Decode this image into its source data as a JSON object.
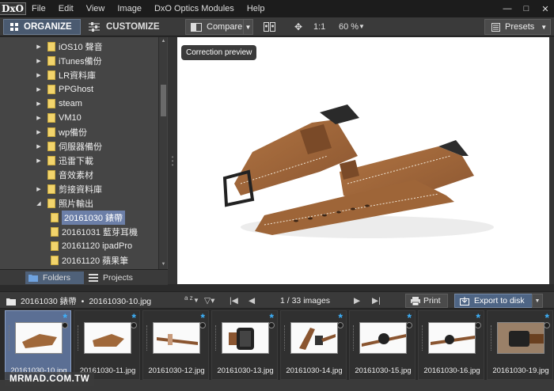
{
  "app": {
    "logo": "DxO"
  },
  "menu": [
    "File",
    "Edit",
    "View",
    "Image",
    "DxO Optics Modules",
    "Help"
  ],
  "toolbar": {
    "organize": "ORGANIZE",
    "customize": "CUSTOMIZE",
    "compare": "Compare",
    "ratio": "1:1",
    "zoom": "60 %",
    "presets": "Presets"
  },
  "folders": [
    {
      "label": "iOS10 聲音",
      "expandable": true,
      "level": 1
    },
    {
      "label": "iTunes備份",
      "expandable": true,
      "level": 1
    },
    {
      "label": "LR資料庫",
      "expandable": true,
      "level": 1
    },
    {
      "label": "PPGhost",
      "expandable": true,
      "level": 1
    },
    {
      "label": "steam",
      "expandable": true,
      "level": 1
    },
    {
      "label": "VM10",
      "expandable": true,
      "level": 1
    },
    {
      "label": "wp備份",
      "expandable": true,
      "level": 1
    },
    {
      "label": "伺服器備份",
      "expandable": true,
      "level": 1
    },
    {
      "label": "迅雷下載",
      "expandable": true,
      "level": 1
    },
    {
      "label": "音效素材",
      "expandable": false,
      "level": 1
    },
    {
      "label": "剪接資料庫",
      "expandable": true,
      "level": 1
    },
    {
      "label": "照片輸出",
      "expandable": true,
      "expanded": true,
      "level": 1
    },
    {
      "label": "20161030 錶帶",
      "expandable": false,
      "level": 2,
      "selected": true
    },
    {
      "label": "20161031 藍芽耳機",
      "expandable": false,
      "level": 2
    },
    {
      "label": "20161120 ipadPro",
      "expandable": false,
      "level": 2
    },
    {
      "label": "20161120 蘋果筆",
      "expandable": false,
      "level": 2
    }
  ],
  "left_tabs": {
    "folders": "Folders",
    "projects": "Projects"
  },
  "preview": {
    "badge": "Correction preview"
  },
  "filmstrip_bar": {
    "folder": "20161030 錶帶",
    "file": "20161030-10.jpg",
    "sort_label": "a z",
    "count": "1 / 33 images",
    "print": "Print",
    "export": "Export to disk"
  },
  "thumbnails": [
    {
      "label": "20161030-10.jpg",
      "selected": true
    },
    {
      "label": "20161030-11.jpg"
    },
    {
      "label": "20161030-12.jpg"
    },
    {
      "label": "20161030-13.jpg"
    },
    {
      "label": "20161030-14.jpg"
    },
    {
      "label": "20161030-15.jpg"
    },
    {
      "label": "20161030-16.jpg"
    },
    {
      "label": "20161030-19.jpg"
    }
  ],
  "watermark": "MRMAD.COM.TW",
  "colors": {
    "accent": "#4e6585",
    "star": "#3db3ff",
    "folder": "#f2d46c"
  }
}
